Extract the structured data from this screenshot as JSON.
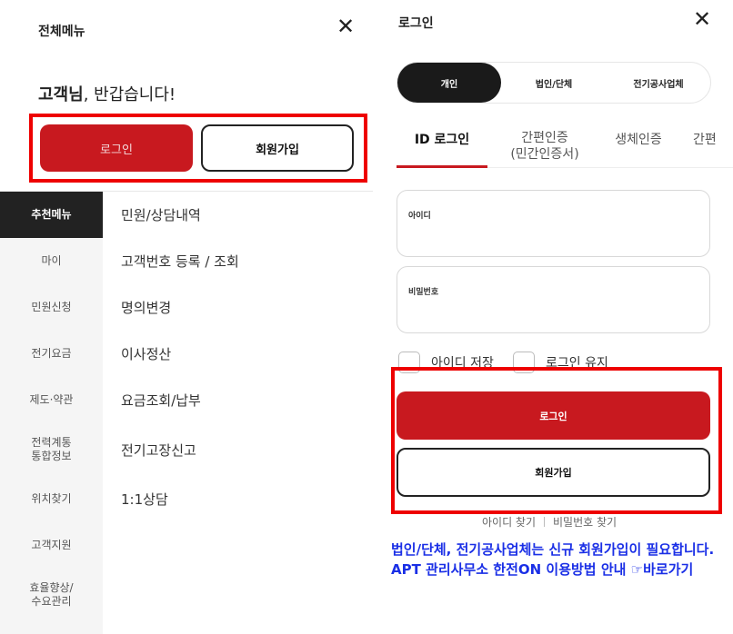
{
  "left_panel": {
    "title": "전체메뉴",
    "close_icon": "close-icon",
    "greeting_name": "고객님",
    "greeting_rest": ", 반갑습니다!",
    "login_label": "로그인",
    "join_label": "회원가입",
    "categories": [
      {
        "label": "추천메뉴",
        "active": true
      },
      {
        "label": "마이"
      },
      {
        "label": "민원신청"
      },
      {
        "label": "전기요금"
      },
      {
        "label": "제도·약관"
      },
      {
        "label": "전력계통\n통합정보"
      },
      {
        "label": "위치찾기"
      },
      {
        "label": "고객지원"
      },
      {
        "label": "효율향상/\n수요관리"
      }
    ],
    "submenu": [
      "민원/상담내역",
      "고객번호 등록 / 조회",
      "명의변경",
      "이사정산",
      "요금조회/납부",
      "전기고장신고",
      "1:1상담"
    ]
  },
  "right_panel": {
    "title": "로그인",
    "close_icon": "close-icon",
    "segments": [
      "개인",
      "법인/단체",
      "전기공사업체"
    ],
    "tabs": [
      "ID 로그인",
      "간편인증\n(민간인증서)",
      "생체인증",
      "간편"
    ],
    "id_label": "아이디",
    "id_value": "",
    "pw_label": "비밀번호",
    "pw_value": "",
    "save_id_label": "아이디 저장",
    "keep_login_label": "로그인 유지",
    "login_button": "로그인",
    "join_button": "회원가입",
    "find_id": "아이디 찾기",
    "find_pw": "비밀번호 찾기",
    "notice": "법인/단체, 전기공사업체는 신규 회원가입이 필요합니다. APT 관리사무소 한전ON 이용방법 안내 ☞바로가기"
  },
  "colors": {
    "brand_red": "#c8191f",
    "highlight_red": "#ee0000",
    "notice_blue": "#1a2fe6"
  }
}
